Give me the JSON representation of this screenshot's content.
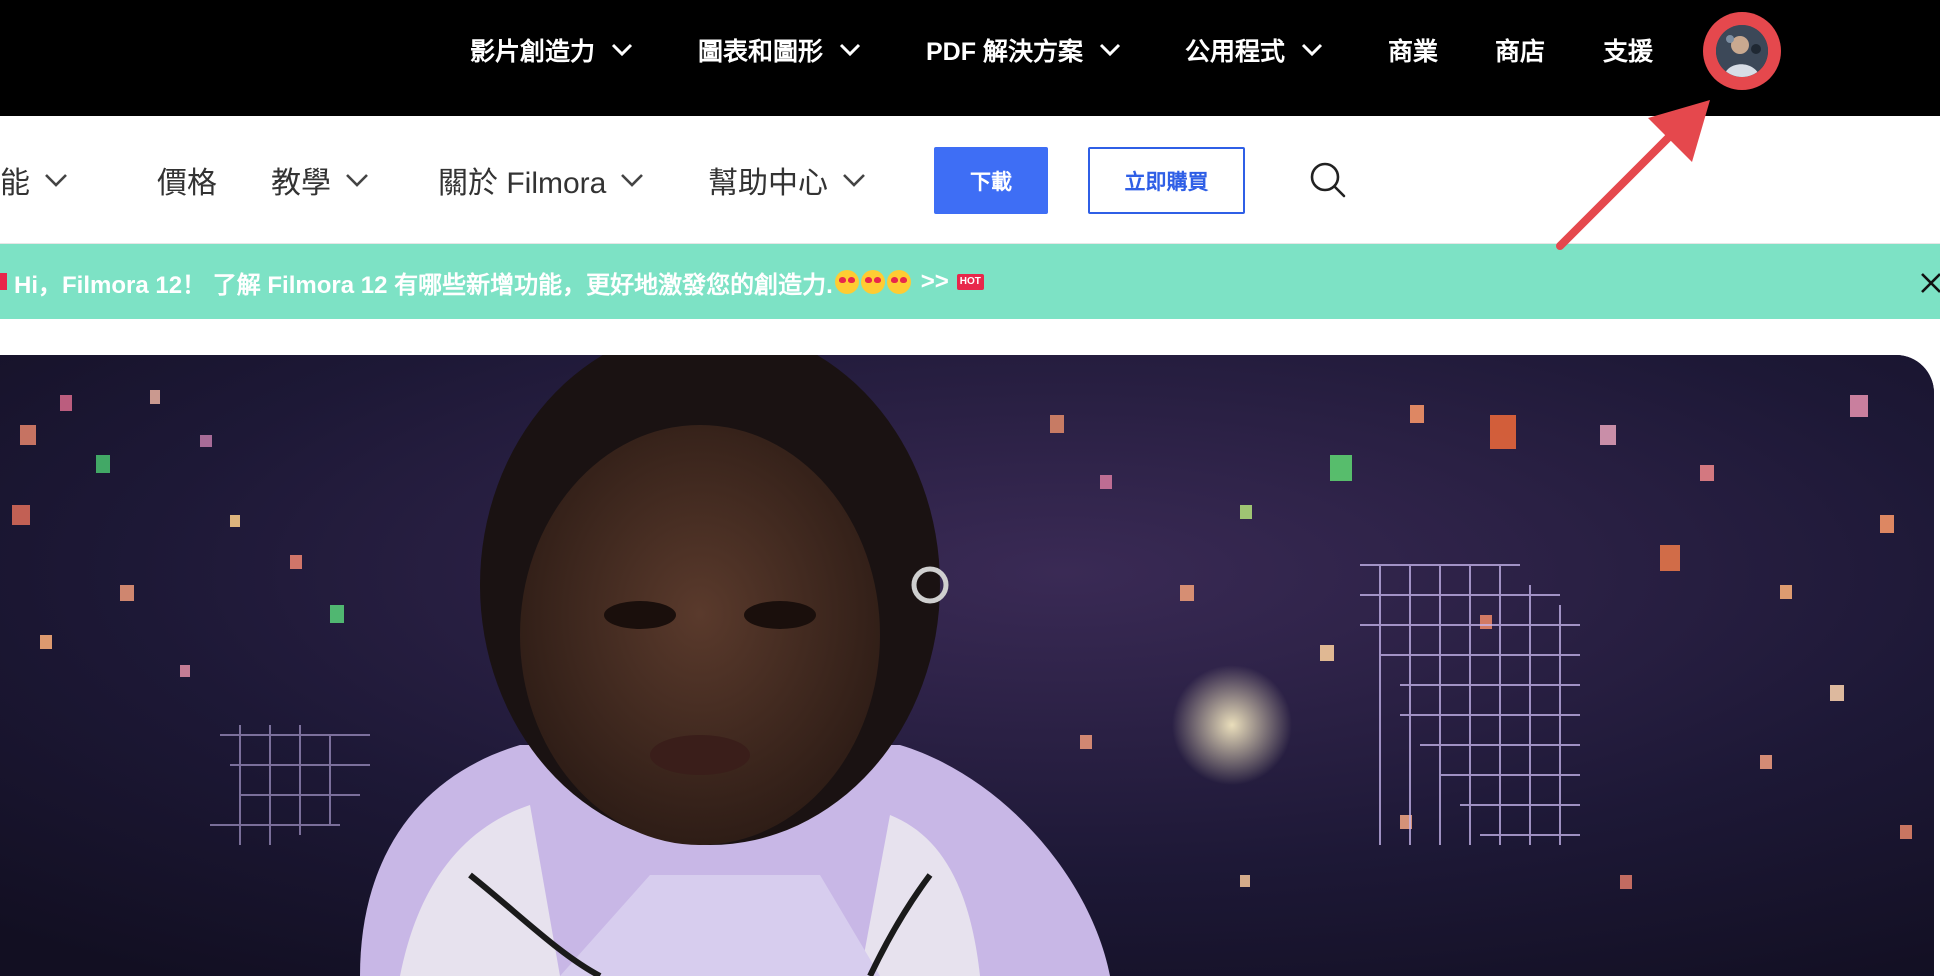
{
  "global_nav": {
    "items": [
      {
        "label": "影片創造力",
        "has_dropdown": true
      },
      {
        "label": "圖表和圖形",
        "has_dropdown": true
      },
      {
        "label": "PDF 解決方案",
        "has_dropdown": true
      },
      {
        "label": "公用程式",
        "has_dropdown": true
      },
      {
        "label": "商業",
        "has_dropdown": false
      },
      {
        "label": "商店",
        "has_dropdown": false
      },
      {
        "label": "支援",
        "has_dropdown": false
      }
    ],
    "avatar_icon": "user-avatar-icon",
    "avatar_highlight_color": "#e5484d"
  },
  "sub_nav": {
    "items": [
      {
        "label": "功能",
        "has_dropdown": true
      },
      {
        "label": "價格",
        "has_dropdown": false
      },
      {
        "label": "教學",
        "has_dropdown": true
      },
      {
        "label": "關於 Filmora",
        "has_dropdown": true
      },
      {
        "label": "幫助中心",
        "has_dropdown": true
      }
    ],
    "download_label": "下載",
    "buy_label": "立即購買",
    "search_icon": "search-icon",
    "accent_color": "#3e6ef5"
  },
  "banner": {
    "text": "Hi，Filmora 12！ 了解 Filmora 12 有哪些新增功能，更好地激發您的創造力.",
    "link_suffix": ">>",
    "hot_label": "HOT",
    "close_icon": "close-icon",
    "background_color": "#7de2c5"
  },
  "hero": {
    "media_icon": "hero-video-frame"
  },
  "annotation": {
    "arrow_icon": "red-arrow-icon",
    "color": "#e5484d"
  }
}
